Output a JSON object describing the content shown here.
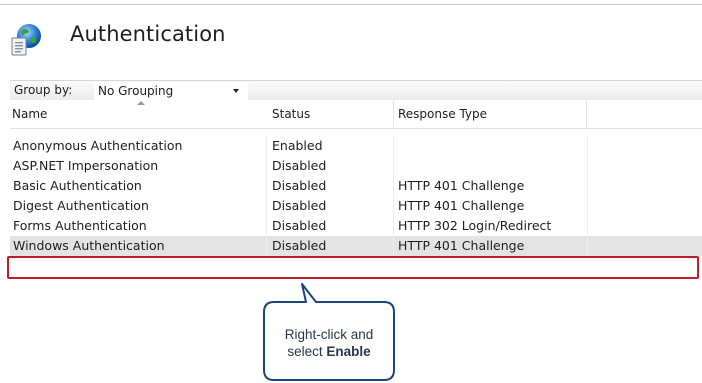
{
  "header": {
    "title": "Authentication",
    "icon": "authentication-globe-icon"
  },
  "toolbar": {
    "group_by_label": "Group by:",
    "group_by_value": "No Grouping"
  },
  "table": {
    "columns": [
      "Name",
      "Status",
      "Response Type",
      ""
    ],
    "rows": [
      {
        "name": "Anonymous Authentication",
        "status": "Enabled",
        "response": ""
      },
      {
        "name": "ASP.NET Impersonation",
        "status": "Disabled",
        "response": ""
      },
      {
        "name": "Basic Authentication",
        "status": "Disabled",
        "response": "HTTP 401 Challenge"
      },
      {
        "name": "Digest Authentication",
        "status": "Disabled",
        "response": "HTTP 401 Challenge"
      },
      {
        "name": "Forms Authentication",
        "status": "Disabled",
        "response": "HTTP 302 Login/Redirect"
      },
      {
        "name": "Windows Authentication",
        "status": "Disabled",
        "response": "HTTP 401 Challenge"
      }
    ],
    "selected_row": "Windows Authentication"
  },
  "callout": {
    "line1": "Right-click and",
    "line2_prefix": "select ",
    "line2_bold": "Enable"
  },
  "colors": {
    "highlight_border": "#c01c2b",
    "callout_border": "#1e4578",
    "callout_text": "#27374c",
    "selected_row": "#e3e3e3"
  }
}
